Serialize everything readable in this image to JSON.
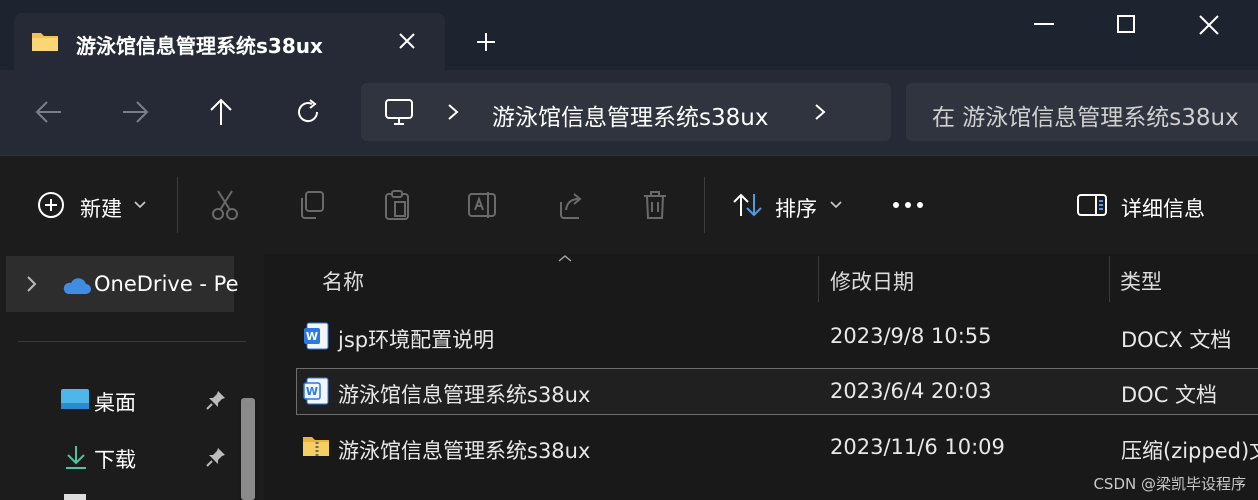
{
  "window": {
    "tab_title": "游泳馆信息管理系统s38ux",
    "icons": [
      "folder-icon",
      "close-tab-icon",
      "new-tab-icon",
      "minimize-icon",
      "maximize-icon",
      "close-window-icon"
    ]
  },
  "nav": {
    "breadcrumb": "游泳馆信息管理系统s38ux",
    "search_placeholder": "在 游泳馆信息管理系统s38ux",
    "icons": [
      "back-icon",
      "forward-icon",
      "up-icon",
      "refresh-icon",
      "computer-icon",
      "chevron-right-icon"
    ]
  },
  "toolbar": {
    "new_label": "新建",
    "sort_label": "排序",
    "details_label": "详细信息",
    "icons": [
      "plus-circle-icon",
      "cut-icon",
      "copy-icon",
      "paste-icon",
      "rename-icon",
      "share-icon",
      "delete-icon",
      "sort-icon",
      "more-icon",
      "details-pane-icon"
    ]
  },
  "sidebar": {
    "items": [
      {
        "label": "OneDrive - Pe",
        "icon": "cloud-icon"
      },
      {
        "label": "桌面",
        "icon": "desktop-icon",
        "pinned": true
      },
      {
        "label": "下载",
        "icon": "download-icon",
        "pinned": true
      }
    ]
  },
  "table": {
    "columns": [
      "名称",
      "修改日期",
      "类型"
    ],
    "rows": [
      {
        "name": "jsp环境配置说明",
        "date": "2023/9/8 10:55",
        "type": "DOCX 文档",
        "icon": "word-doc-icon"
      },
      {
        "name": "游泳馆信息管理系统s38ux",
        "date": "2023/6/4 20:03",
        "type": "DOC 文档",
        "icon": "word-doc-icon",
        "selected": true
      },
      {
        "name": "游泳馆信息管理系统s38ux",
        "date": "2023/11/6 10:09",
        "type": "压缩(zipped)文",
        "icon": "zip-folder-icon"
      }
    ]
  },
  "watermark": "CSDN @梁凯毕设程序",
  "colors": {
    "accent": "#4f9be6",
    "folder": "#f2c14e",
    "word": "#2b78e4"
  }
}
